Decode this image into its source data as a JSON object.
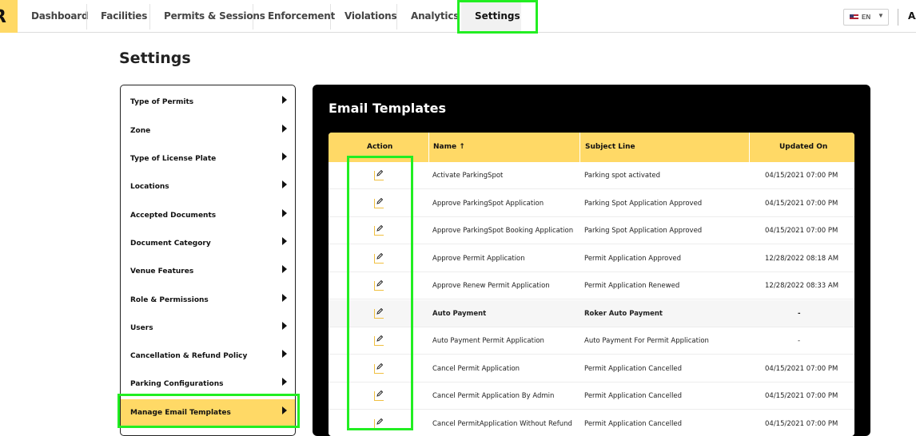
{
  "logo_text": "R",
  "nav": {
    "items": [
      "Dashboard",
      "Facilities",
      "Permits & Sessions",
      "Enforcement",
      "Violations",
      "Analytics"
    ],
    "active": "Settings"
  },
  "lang": {
    "code": "EN",
    "caret": "▼",
    "flag": "us-flag-icon"
  },
  "user_initials": "AA",
  "page_title": "Settings",
  "side_menu": {
    "items": [
      "Type of Permits",
      "Zone",
      "Type of License Plate",
      "Locations",
      "Accepted Documents",
      "Document Category",
      "Venue Features",
      "Role & Permissions",
      "Users",
      "Cancellation & Refund Policy",
      "Parking Configurations",
      "Manage Email Templates"
    ],
    "active_index": 11
  },
  "panel": {
    "title": "Email Templates",
    "columns": {
      "action": "Action",
      "name": "Name ↑",
      "subject": "Subject Line",
      "updated": "Updated On"
    },
    "rows": [
      {
        "name": "Activate ParkingSpot",
        "subject": "Parking spot activated",
        "updated": "04/15/2021 07:00 PM"
      },
      {
        "name": "Approve ParkingSpot Application",
        "subject": "Parking Spot Application Approved",
        "updated": "04/15/2021 07:00 PM"
      },
      {
        "name": "Approve ParkingSpot Booking Application",
        "subject": "Parking Spot Application Approved",
        "updated": "04/15/2021 07:00 PM"
      },
      {
        "name": "Approve Permit Application",
        "subject": "Permit Application Approved",
        "updated": "12/28/2022 08:18 AM"
      },
      {
        "name": "Approve Renew Permit Application",
        "subject": "Permit Application Renewed",
        "updated": "12/28/2022 08:33 AM"
      },
      {
        "name": "Auto Payment",
        "subject": "Roker Auto Payment",
        "updated": "-"
      },
      {
        "name": "Auto Payment Permit Application",
        "subject": "Auto Payment For Permit Application",
        "updated": "-"
      },
      {
        "name": "Cancel Permit Application",
        "subject": "Permit Application Cancelled",
        "updated": "04/15/2021 07:00 PM"
      },
      {
        "name": "Cancel Permit Application By Admin",
        "subject": "Permit Application Cancelled",
        "updated": "04/15/2021 07:00 PM"
      },
      {
        "name": "Cancel PermitApplication Without Refund",
        "subject": "Permit Application Cancelled",
        "updated": "04/15/2021 07:00 PM"
      }
    ]
  },
  "colors": {
    "accent": "#ffd966",
    "highlight": "#22ee22",
    "panel_bg": "#000000"
  }
}
